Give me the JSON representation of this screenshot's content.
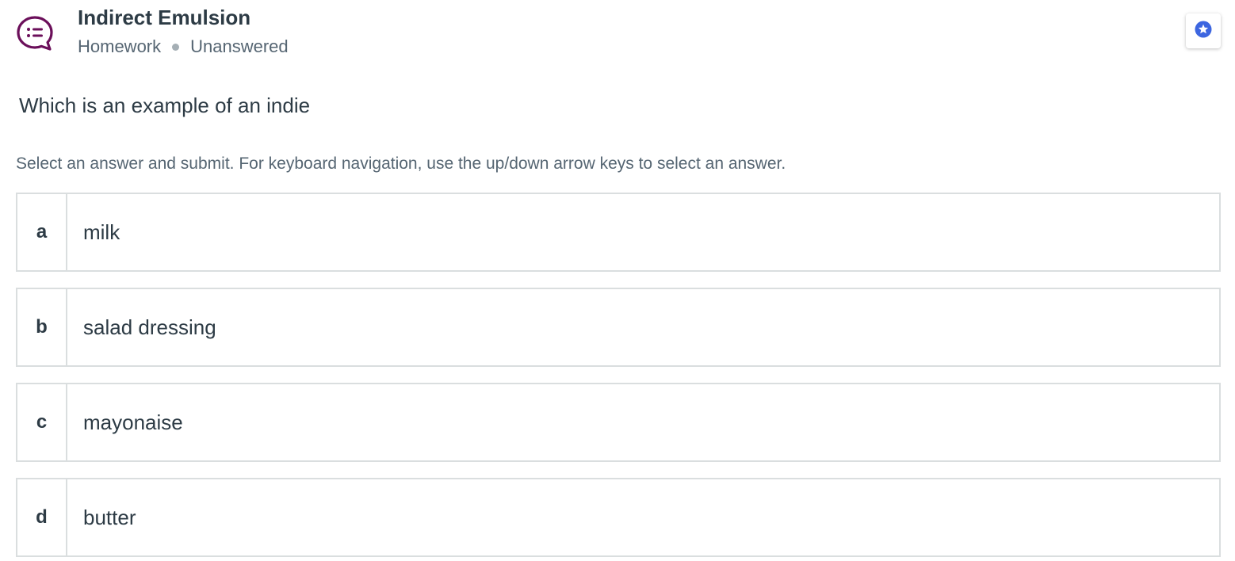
{
  "header": {
    "icon": "chat-list-icon",
    "title": "Indirect Emulsion",
    "category": "Homework",
    "status": "Unanswered",
    "star_icon": "star-icon",
    "colors": {
      "icon_accent": "#6b0f5a",
      "star_accent": "#3d66e0"
    }
  },
  "question": {
    "text": "Which is an example of an indie",
    "instructions": "Select an answer and submit. For keyboard navigation, use the up/down arrow keys to select an answer."
  },
  "answers": [
    {
      "letter": "a",
      "text": "milk"
    },
    {
      "letter": "b",
      "text": "salad dressing"
    },
    {
      "letter": "c",
      "text": "mayonaise"
    },
    {
      "letter": "d",
      "text": "butter"
    }
  ]
}
